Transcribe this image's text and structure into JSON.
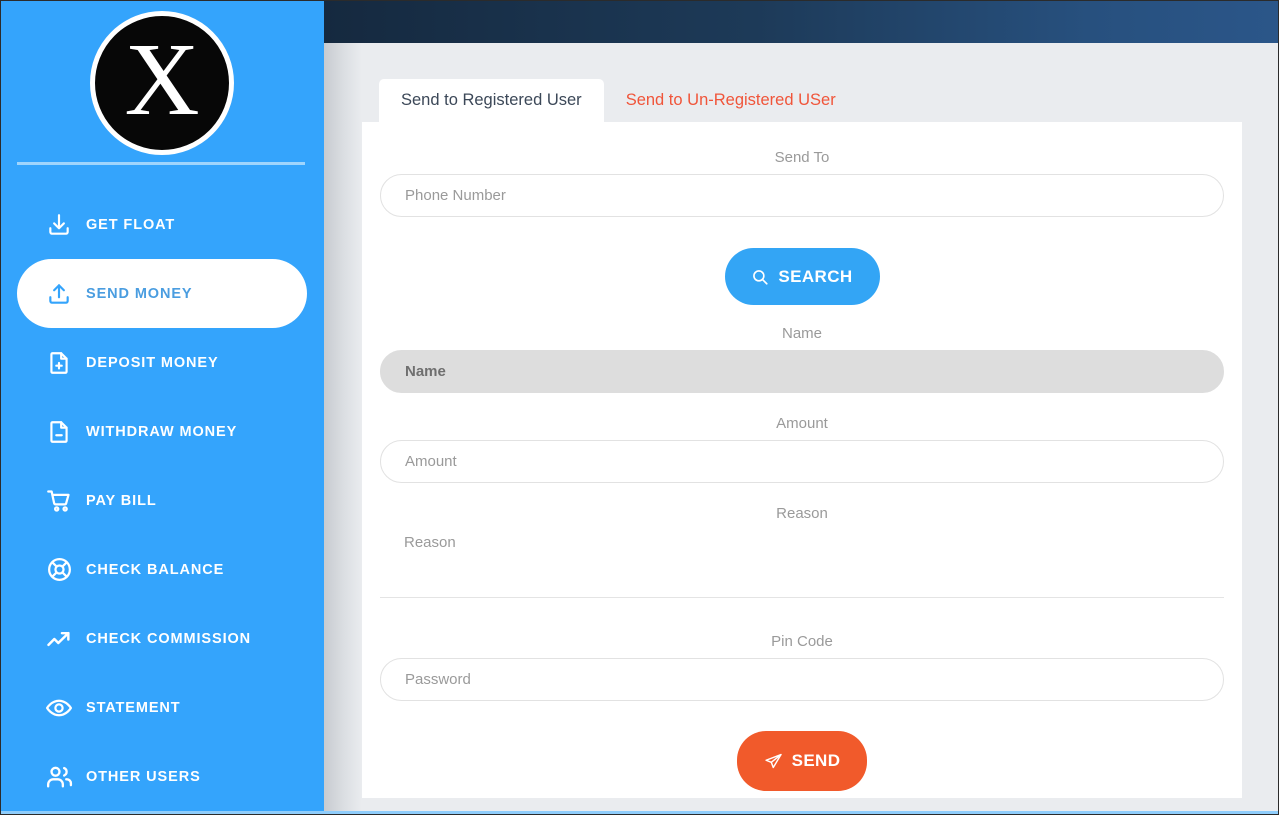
{
  "sidebar": {
    "logo": {
      "letter": "X",
      "icon": "logo-x-circle"
    },
    "items": [
      {
        "label": "GET FLOAT",
        "icon": "download-icon",
        "active": false
      },
      {
        "label": "SEND MONEY",
        "icon": "upload-icon",
        "active": true
      },
      {
        "label": "DEPOSIT MONEY",
        "icon": "file-plus-icon",
        "active": false
      },
      {
        "label": "WITHDRAW MONEY",
        "icon": "file-minus-icon",
        "active": false
      },
      {
        "label": "PAY BILL",
        "icon": "cart-icon",
        "active": false
      },
      {
        "label": "CHECK BALANCE",
        "icon": "lifebuoy-icon",
        "active": false
      },
      {
        "label": "CHECK COMMISSION",
        "icon": "trend-up-icon",
        "active": false
      },
      {
        "label": "STATEMENT",
        "icon": "eye-icon",
        "active": false
      },
      {
        "label": "OTHER USERS",
        "icon": "users-icon",
        "active": false
      }
    ]
  },
  "tabs": [
    {
      "label": "Send to Registered User",
      "active": true
    },
    {
      "label": "Send to Un-Registered USer",
      "active": false
    }
  ],
  "form": {
    "send_to": {
      "label": "Send To",
      "placeholder": "Phone Number",
      "value": ""
    },
    "name": {
      "label": "Name",
      "placeholder": "Name",
      "value": "",
      "disabled": true
    },
    "amount": {
      "label": "Amount",
      "placeholder": "Amount",
      "value": ""
    },
    "reason": {
      "label": "Reason",
      "placeholder": "Reason",
      "value": ""
    },
    "pin_code": {
      "label": "Pin Code",
      "placeholder": "Password",
      "value": ""
    }
  },
  "buttons": {
    "search": {
      "label": "SEARCH",
      "icon": "search-icon",
      "color": "#33a5f5"
    },
    "send": {
      "label": "SEND",
      "icon": "paper-plane-icon",
      "color": "#f15a2b"
    }
  },
  "colors": {
    "sidebar": "#34a4fc",
    "topbar_start": "#15293f",
    "topbar_end": "#2b5689",
    "accent_orange": "#f15a2b",
    "accent_blue": "#33a5f5",
    "page_background": "#eaecef"
  }
}
